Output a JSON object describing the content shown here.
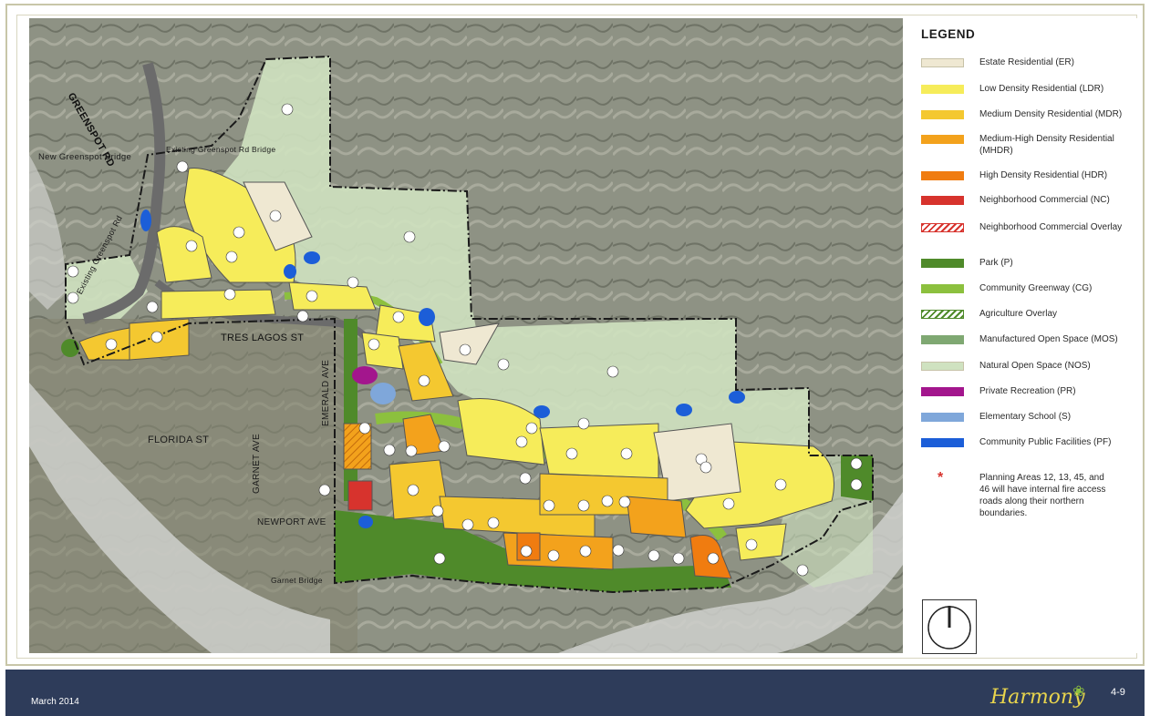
{
  "map": {
    "street_labels": {
      "greenspot_rd": "GREENSPOT RD",
      "new_greenspot_bridge": "New  Greenspot Bridge",
      "existing_greenspot_bridge": "Existing Greenspot Rd Bridge",
      "existing_greenspot_rd": "Existing Greenspot Rd",
      "tres_lagos_st": "TRES LAGOS ST",
      "emerald_ave": "EMERALD AVE",
      "florida_st": "FLORIDA ST",
      "garnet_ave": "GARNET AVE",
      "newport_ave": "NEWPORT AVE",
      "garnet_bridge": "Garnet Bridge"
    },
    "parcel_labels": [
      "PA 1",
      "PA 2",
      "PA 3",
      "PA 7",
      "PA 8",
      "PA 9",
      "PA 10",
      "PA 11",
      "PA 12",
      "PA 13",
      "PA 14",
      "PA 15",
      "PA 17",
      "PA 18",
      "PA 19",
      "PA 20",
      "PA 21",
      "PA 22",
      "PA 23",
      "PA 24",
      "PA 25",
      "PA 27",
      "PA 29",
      "PA 30",
      "PA 31",
      "PA 32",
      "PA 33",
      "PA 34",
      "PA 35",
      "PA 37",
      "PA 38",
      "PA 39",
      "PA 40",
      "PA 41",
      "PA 42",
      "PA 43",
      "PA 45",
      "PA 46",
      "PA 47",
      "PA 60",
      "PA 62",
      "PA 64",
      "PA 69",
      "PA 70",
      "PA 72"
    ],
    "facility_labels": [
      "A",
      "B",
      "C",
      "D",
      "E",
      "F",
      "G",
      "H",
      "I",
      "NAP"
    ]
  },
  "legend": {
    "title": "LEGEND",
    "items": [
      {
        "label": "Estate Residential (ER)",
        "color": "#efe8d2",
        "style": "solid"
      },
      {
        "label": "Low Density Residential (LDR)",
        "color": "#f6ec5a",
        "style": "solid"
      },
      {
        "label": "Medium Density Residential (MDR)",
        "color": "#f4c830",
        "style": "solid"
      },
      {
        "label": "Medium-High Density Residential (MHDR)",
        "color": "#f3a21c",
        "style": "solid"
      },
      {
        "label": "High Density Residential (HDR)",
        "color": "#f07c10",
        "style": "solid"
      },
      {
        "label": "Neighborhood Commercial (NC)",
        "color": "#d7332d",
        "style": "solid"
      },
      {
        "label": "Neighborhood Commercial Overlay",
        "color": "#d7332d",
        "style": "hatch"
      },
      {
        "label": "Park (P)",
        "color": "#4f8a2a",
        "style": "solid"
      },
      {
        "label": "Community Greenway (CG)",
        "color": "#8cc03e",
        "style": "solid"
      },
      {
        "label": "Agriculture Overlay",
        "color": "#4f8a2a",
        "style": "hatch"
      },
      {
        "label": "Manufactured Open Space (MOS)",
        "color": "#7fa872",
        "style": "solid"
      },
      {
        "label": "Natural Open Space (NOS)",
        "color": "#cfe2c0",
        "style": "solid"
      },
      {
        "label": "Private Recreation (PR)",
        "color": "#a3168d",
        "style": "solid"
      },
      {
        "label": "Elementary School (S)",
        "color": "#7fa7da",
        "style": "solid"
      },
      {
        "label": "Community Public Facilities (PF)",
        "color": "#1c5ed8",
        "style": "solid"
      }
    ],
    "note": "Planning Areas 12, 13, 45, and 46 will have internal fire access roads along their northern boundaries.",
    "note_mark": "*"
  },
  "footer": {
    "date": "March 2014",
    "logo": "Harmony",
    "page": "4-9"
  }
}
